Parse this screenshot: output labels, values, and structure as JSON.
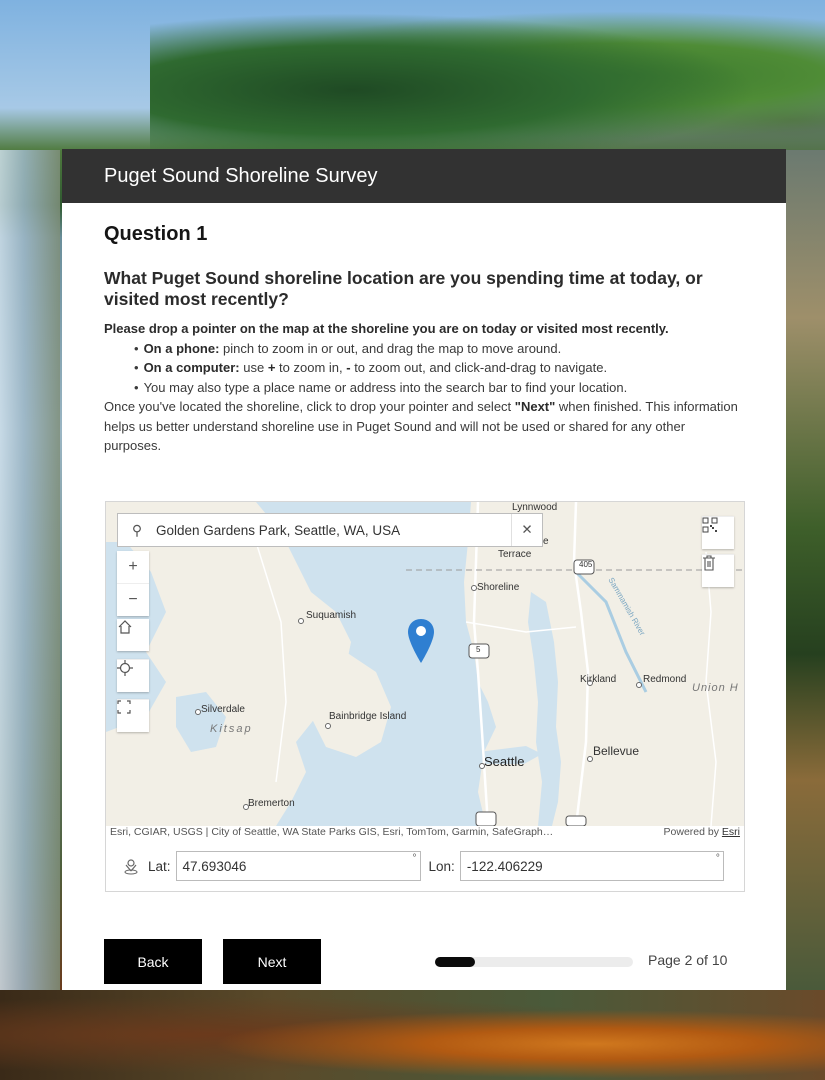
{
  "survey": {
    "title": "Puget Sound Shoreline Survey",
    "question_number": "Question 1",
    "question_text": "What Puget Sound shoreline location are you spending time at today, or visited most recently?",
    "instructions": {
      "lead": "Please drop a pointer on the map at the shoreline you are on today or visited most recently.",
      "bullets": [
        {
          "bold": "On a phone:",
          "text": " pinch to zoom in or out, and drag the map to move around."
        },
        {
          "bold": "On a computer:",
          "text_a": " use ",
          "plus": "+",
          "text_b": " to zoom in, ",
          "minus": "-",
          "text_c": " to zoom out, and click-and-drag to navigate."
        },
        {
          "text": "You may also type a place name or address into the search bar to find your location."
        }
      ],
      "closing_a": "Once you've located the shoreline, click to drop your pointer and select ",
      "closing_bold": "\"Next\"",
      "closing_b": " when finished. This information helps us better understand shoreline use in Puget Sound and will not be used or shared for any other purposes."
    }
  },
  "map": {
    "search_value": "Golden Gardens Park, Seattle, WA, USA",
    "labels": {
      "lynnwood": "Lynnwood",
      "terrace": "Terrace",
      "e": "e",
      "shoreline": "Shoreline",
      "suquamish": "Suquamish",
      "kirkland": "Kirkland",
      "redmond": "Redmond",
      "union_h": "Union H",
      "silverdale": "Silverdale",
      "kitsap": "Kitsap",
      "bainbridge": "Bainbridge Island",
      "seattle": "Seattle",
      "bellevue": "Bellevue",
      "bremerton": "Bremerton",
      "sammamish_river": "Sammamish River",
      "i405": "405",
      "i5": "5"
    },
    "attribution_left": "Esri, CGIAR, USGS | City of Seattle, WA State Parks GIS, Esri, TomTom, Garmin, SafeGraph…",
    "attribution_right_prefix": "Powered by ",
    "attribution_right_link": "Esri",
    "lat_label": "Lat:",
    "lat_value": "47.693046",
    "lon_label": "Lon:",
    "lon_value": "-122.406229",
    "degree": "°"
  },
  "navigation": {
    "back_label": "Back",
    "next_label": "Next",
    "progress_fraction": 0.2,
    "page_label": "Page 2 of 10"
  }
}
